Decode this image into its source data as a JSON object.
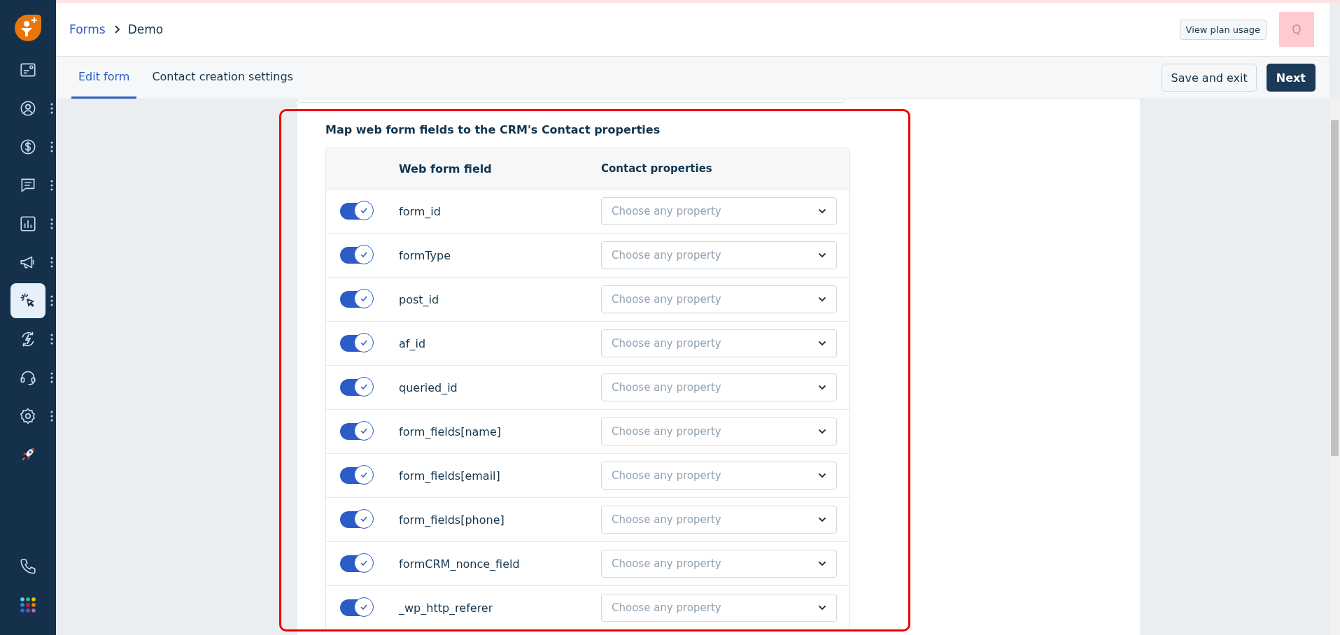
{
  "sidebar": {
    "items": [
      {
        "selected": false
      },
      {
        "selected": false
      },
      {
        "selected": false
      },
      {
        "selected": false
      },
      {
        "selected": false
      },
      {
        "selected": false
      },
      {
        "selected": true
      },
      {
        "selected": false
      },
      {
        "selected": false
      },
      {
        "selected": false
      },
      {
        "selected": false
      }
    ]
  },
  "header": {
    "breadcrumb": [
      "Forms",
      "Demo"
    ],
    "plan_button": "View plan usage",
    "avatar": "Q"
  },
  "tabs": [
    {
      "label": "Edit form",
      "selected": true
    },
    {
      "label": "Contact creation settings",
      "selected": false
    }
  ],
  "actions": {
    "save": "Save and exit",
    "next": "Next"
  },
  "mapping": {
    "title": "Map web form fields to the CRM's Contact properties",
    "columns": [
      "Web form field",
      "Contact properties"
    ],
    "rows": [
      {
        "field": "form_id",
        "enabled": true,
        "placeholder": "Choose any property"
      },
      {
        "field": "formType",
        "enabled": true,
        "placeholder": "Choose any property"
      },
      {
        "field": "post_id",
        "enabled": true,
        "placeholder": "Choose any property"
      },
      {
        "field": "af_id",
        "enabled": true,
        "placeholder": "Choose any property"
      },
      {
        "field": "queried_id",
        "enabled": true,
        "placeholder": "Choose any property"
      },
      {
        "field": "form_fields[name]",
        "enabled": true,
        "placeholder": "Choose any property"
      },
      {
        "field": "form_fields[email]",
        "enabled": true,
        "placeholder": "Choose any property"
      },
      {
        "field": "form_fields[phone]",
        "enabled": true,
        "placeholder": "Choose any property"
      },
      {
        "field": "formCRM_nonce_field",
        "enabled": true,
        "placeholder": "Choose any property"
      },
      {
        "field": "_wp_http_referer",
        "enabled": true,
        "placeholder": "Choose any property"
      }
    ]
  }
}
